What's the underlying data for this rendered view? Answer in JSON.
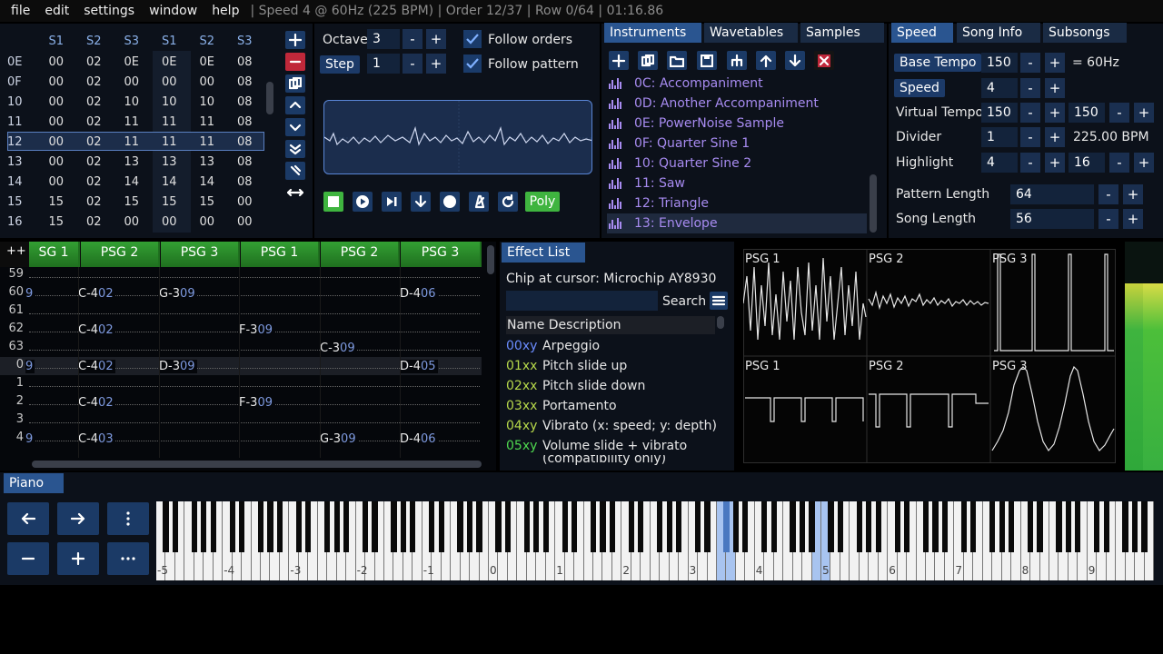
{
  "menu": {
    "items": [
      "file",
      "edit",
      "settings",
      "window",
      "help"
    ],
    "status": "| Speed 4 @ 60Hz (225 BPM) | Order 12/37 | Row 0/64 | 01:16.86"
  },
  "orders": {
    "headers": [
      "",
      "S1",
      "S2",
      "S3",
      "S1",
      "S2",
      "S3"
    ],
    "rows": [
      [
        "0E",
        "00",
        "02",
        "0E",
        "0E",
        "0E",
        "08"
      ],
      [
        "0F",
        "00",
        "02",
        "00",
        "00",
        "00",
        "08"
      ],
      [
        "10",
        "00",
        "02",
        "10",
        "10",
        "10",
        "08"
      ],
      [
        "11",
        "00",
        "02",
        "11",
        "11",
        "11",
        "08"
      ],
      [
        "12",
        "00",
        "02",
        "11",
        "11",
        "11",
        "08"
      ],
      [
        "13",
        "00",
        "02",
        "13",
        "13",
        "13",
        "08"
      ],
      [
        "14",
        "00",
        "02",
        "14",
        "14",
        "14",
        "08"
      ],
      [
        "15",
        "15",
        "02",
        "15",
        "15",
        "15",
        "00"
      ],
      [
        "16",
        "15",
        "02",
        "00",
        "00",
        "00",
        "00"
      ]
    ],
    "selected_row": 4
  },
  "edit_controls": {
    "octave_label": "Octave",
    "octave_value": "3",
    "step_label": "Step",
    "step_value": "1",
    "follow_orders": "Follow orders",
    "follow_pattern": "Follow pattern",
    "minus": "-",
    "plus": "+",
    "poly": "Poly"
  },
  "instruments": {
    "tabs": [
      "Instruments",
      "Wavetables",
      "Samples"
    ],
    "items": [
      "0C: Accompaniment",
      "0D: Another Accompaniment",
      "0E: PowerNoise Sample",
      "0F: Quarter Sine 1",
      "10: Quarter Sine 2",
      "11: Saw",
      "12: Triangle",
      "13: Envelope"
    ],
    "selected": 7
  },
  "speed": {
    "tabs": [
      "Speed",
      "Song Info",
      "Subsongs"
    ],
    "base_tempo_label": "Base Tempo",
    "base_tempo": "150",
    "hz": "= 60Hz",
    "speed_label": "Speed",
    "speed": "4",
    "virtual_tempo_label": "Virtual Tempo",
    "vt1": "150",
    "vt2": "150",
    "divider_label": "Divider",
    "divider": "1",
    "bpm": "225.00 BPM",
    "highlight_label": "Highlight",
    "hl1": "4",
    "hl2": "16",
    "pattern_length_label": "Pattern Length",
    "pattern_length": "64",
    "song_length_label": "Song Length",
    "song_length": "56"
  },
  "pattern": {
    "plus": "++",
    "channels": [
      "SG 1",
      "PSG 2",
      "PSG 3",
      "PSG 1",
      "PSG 2",
      "PSG 3"
    ],
    "rows": [
      {
        "n": "59",
        "cells": []
      },
      {
        "n": "60",
        "cells": [
          [
            "0",
            "",
            "9"
          ],
          [
            "1",
            "C-4",
            "02"
          ],
          [
            "2",
            "G-3",
            "09"
          ],
          [
            "5",
            "D-4",
            "06"
          ]
        ]
      },
      {
        "n": "61",
        "cells": []
      },
      {
        "n": "62",
        "cells": [
          [
            "1",
            "C-4",
            "02"
          ],
          [
            "3",
            "F-3",
            "09"
          ]
        ]
      },
      {
        "n": "63",
        "cells": [
          [
            "4",
            "C-3",
            "09"
          ]
        ]
      },
      {
        "n": "0",
        "cells": [
          [
            "0",
            "",
            "9"
          ],
          [
            "1",
            "C-4",
            "02"
          ],
          [
            "2",
            "D-3",
            "09"
          ],
          [
            "5",
            "D-4",
            "05"
          ]
        ]
      },
      {
        "n": "1",
        "cells": []
      },
      {
        "n": "2",
        "cells": [
          [
            "1",
            "C-4",
            "02"
          ],
          [
            "3",
            "F-3",
            "09"
          ]
        ]
      },
      {
        "n": "3",
        "cells": []
      },
      {
        "n": "4",
        "cells": [
          [
            "0",
            "",
            "9"
          ],
          [
            "1",
            "C-4",
            "03"
          ],
          [
            "4",
            "G-3",
            "09"
          ],
          [
            "5",
            "D-4",
            "06"
          ]
        ]
      }
    ]
  },
  "effects": {
    "tab": "Effect List",
    "chip": "Chip at cursor: Microchip AY8930",
    "search": "Search",
    "header": "Name Description",
    "items": [
      [
        "00xy",
        "Arpeggio"
      ],
      [
        "01xx",
        "Pitch slide up"
      ],
      [
        "02xx",
        "Pitch slide down"
      ],
      [
        "03xx",
        "Portamento"
      ],
      [
        "04xy",
        "Vibrato (x: speed; y: depth)"
      ],
      [
        "05xy",
        "Volume slide + vibrato"
      ]
    ],
    "cut_text": "(compatibility only)"
  },
  "oscilloscopes": {
    "labels": [
      "PSG 1",
      "PSG 2",
      "PSG 3",
      "PSG 1",
      "PSG 2",
      "PSG 3"
    ]
  },
  "piano": {
    "tab": "Piano",
    "octaves": [
      "-5",
      "-4",
      "-3",
      "-2",
      "-1",
      "0",
      "1",
      "2",
      "3",
      "4",
      "5",
      "6",
      "7",
      "8",
      "9"
    ]
  },
  "colors": {
    "accent": "#2a5590",
    "green": "#3fb43f",
    "instrument": "#a78bf0",
    "effect_code": "#b6d84a"
  }
}
